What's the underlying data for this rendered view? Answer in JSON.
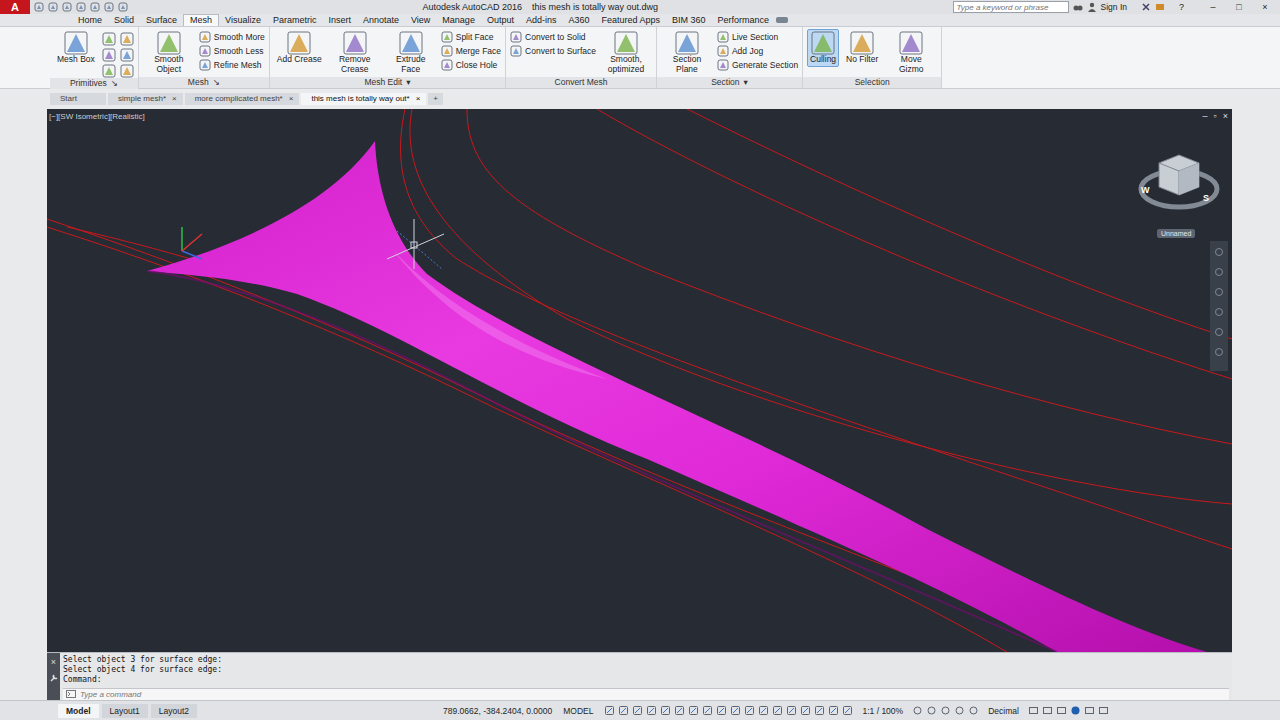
{
  "title_bar": {
    "app_icon": "A",
    "title": "Autodesk AutoCAD 2016    this mesh is totally way out.dwg",
    "search": {
      "placeholder": "Type a keyword or phrase"
    },
    "sign_in": "Sign In",
    "help": "?",
    "window_buttons": [
      "–",
      "□",
      "×"
    ]
  },
  "ribbon_tabs": [
    {
      "label": "Home",
      "selected": false
    },
    {
      "label": "Solid",
      "selected": false
    },
    {
      "label": "Surface",
      "selected": false
    },
    {
      "label": "Mesh",
      "selected": true
    },
    {
      "label": "Visualize",
      "selected": false
    },
    {
      "label": "Parametric",
      "selected": false
    },
    {
      "label": "Insert",
      "selected": false
    },
    {
      "label": "Annotate",
      "selected": false
    },
    {
      "label": "View",
      "selected": false
    },
    {
      "label": "Manage",
      "selected": false
    },
    {
      "label": "Output",
      "selected": false
    },
    {
      "label": "Add-ins",
      "selected": false
    },
    {
      "label": "A360",
      "selected": false
    },
    {
      "label": "Featured Apps",
      "selected": false
    },
    {
      "label": "BIM 360",
      "selected": false
    },
    {
      "label": "Performance",
      "selected": false
    }
  ],
  "ribbon_panels": [
    {
      "title": "Primitives",
      "arrow": "↘",
      "items": [
        {
          "kind": "large",
          "label": "Mesh Box",
          "on": false
        },
        {
          "kind": "icon",
          "on": false
        },
        {
          "kind": "icon",
          "on": false
        },
        {
          "kind": "icon",
          "on": false
        },
        {
          "kind": "icon",
          "on": false
        },
        {
          "kind": "icon",
          "on": false
        },
        {
          "kind": "icon",
          "on": false
        }
      ]
    },
    {
      "title": "Mesh",
      "arrow": "↘",
      "items": [
        {
          "kind": "large",
          "label": "Smooth Object",
          "on": false
        },
        {
          "kind": "small",
          "label": "Smooth More",
          "on": false
        },
        {
          "kind": "small",
          "label": "Smooth Less",
          "on": false
        },
        {
          "kind": "small",
          "label": "Refine Mesh",
          "on": false
        }
      ]
    },
    {
      "title": "Mesh Edit",
      "arrow": "▾",
      "items": [
        {
          "kind": "large",
          "label": "Add Crease",
          "on": false
        },
        {
          "kind": "large",
          "label": "Remove Crease",
          "on": false
        },
        {
          "kind": "large",
          "label": "Extrude Face",
          "on": false
        },
        {
          "kind": "small",
          "label": "Split Face",
          "on": false
        },
        {
          "kind": "small",
          "label": "Merge Face",
          "on": false
        },
        {
          "kind": "small",
          "label": "Close Hole",
          "on": false
        }
      ]
    },
    {
      "title": "Convert Mesh",
      "arrow": "",
      "items": [
        {
          "kind": "small",
          "label": "Convert to Solid",
          "on": false
        },
        {
          "kind": "small",
          "label": "Convert to Surface",
          "on": false
        },
        {
          "kind": "large",
          "label": "Smooth, optimized",
          "on": false
        }
      ]
    },
    {
      "title": "Section",
      "arrow": "▾",
      "items": [
        {
          "kind": "large",
          "label": "Section Plane",
          "on": false
        },
        {
          "kind": "small",
          "label": "Live Section",
          "on": false
        },
        {
          "kind": "small",
          "label": "Add Jog",
          "on": false
        },
        {
          "kind": "small",
          "label": "Generate Section",
          "on": false
        }
      ]
    },
    {
      "title": "Selection",
      "arrow": "",
      "items": [
        {
          "kind": "large",
          "label": "Culling",
          "on": true
        },
        {
          "kind": "large",
          "label": "No Filter",
          "on": false
        },
        {
          "kind": "large",
          "label": "Move Gizmo",
          "on": false
        }
      ]
    }
  ],
  "file_tabs": [
    {
      "label": "Start",
      "close": "",
      "selected": false
    },
    {
      "label": "simple mesh*",
      "close": "×",
      "selected": false
    },
    {
      "label": "more complicated mesh*",
      "close": "×",
      "selected": false
    },
    {
      "label": "this mesh is totally way out*",
      "close": "×",
      "selected": true
    }
  ],
  "new_tab": "+",
  "viewport": {
    "label": "[−][SW Isometric][Realistic]",
    "controls": [
      "–",
      "▫",
      "×"
    ],
    "viewcube": {
      "compass": [
        "W",
        "S"
      ],
      "view_name": "Unnamed"
    }
  },
  "command_history": [
    "Select object 3 for surface edge:",
    "Select object 4 for surface edge:",
    "Command:"
  ],
  "command_close": "×",
  "command_input": {
    "placeholder": "Type a command"
  },
  "layout_tabs": [
    {
      "label": "Model",
      "selected": true
    },
    {
      "label": "Layout1",
      "selected": false
    },
    {
      "label": "Layout2",
      "selected": false
    }
  ],
  "status_bar": {
    "coordinates": "789.0662, -384.2404, 0.0000",
    "space": "MODEL",
    "scale": "1:1 / 100%",
    "units": "Decimal"
  }
}
